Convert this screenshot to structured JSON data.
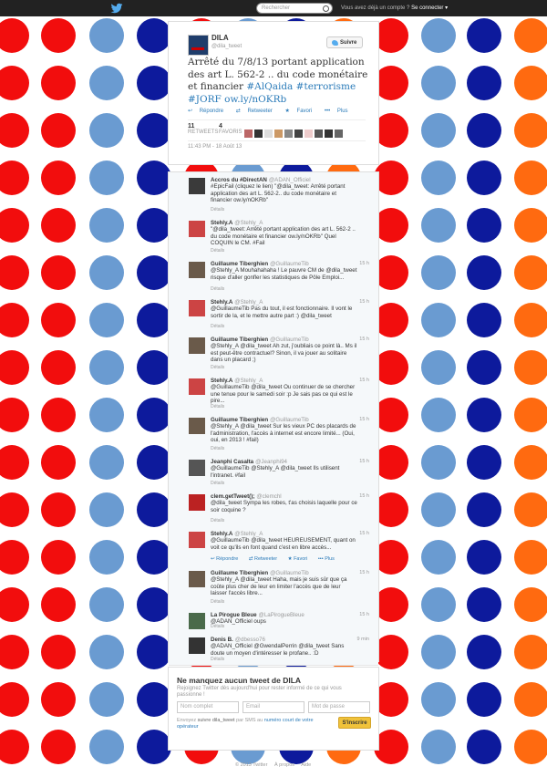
{
  "colors": {
    "red": "#f20d0d",
    "lightblue": "#6a9bd1",
    "navy": "#0d1a9c",
    "orange": "#ff6a10",
    "link": "#2b7bb9",
    "topbar": "#222222"
  },
  "topbar": {
    "search_placeholder": "Rechercher",
    "account_text": "Vous avez déjà un compte ?",
    "login_label": "Se connecter"
  },
  "tweet": {
    "name": "DILA",
    "handle": "@dila_tweet",
    "follow_label": "Suivre",
    "text_plain": "Arrêté du 7/8/13 portant application des art L. 562-2 .. du code monétaire et financier ",
    "hashtag1": "#AlQaida",
    "hashtag2": "#terrorisme",
    "hashtag3": "#JORF",
    "link": "ow.ly/nOKRb",
    "actions": {
      "reply": "Répondre",
      "retweet": "Retweeter",
      "fav": "Favori",
      "more": "Plus"
    },
    "retweets_count": "11",
    "retweets_label": "RETWEETS",
    "favs_count": "4",
    "favs_label": "FAVORIS",
    "timestamp": "11:43 PM - 18 Août 13"
  },
  "replies": [
    {
      "name": "Accros du #DirectAN",
      "handle": "@ADAN_Officiel",
      "time": "",
      "text": "#EpicFail (cliquez le lien) \"@dila_tweet: Arrêté portant application des art L. 562-2.. du code monétaire et financier ow.ly/nOKRb\"",
      "details": "Détails"
    },
    {
      "name": "Stehly.A",
      "handle": "@Stehly_A",
      "time": "",
      "text": "\"@dila_tweet: Arrêté portant application des art L. 562-2 .. du code monétaire et financier ow.ly/nOKRb\" Quel COQUIN le CM. #Fail",
      "details": "Détails"
    },
    {
      "name": "Guillaume Tiberghien",
      "handle": "@GuillaumeTib",
      "time": "15 h",
      "text": "@Stehly_A Mouhahahaha ! Le pauvre CM de @dila_tweet risque d'aller gonfler les statistiques de Pôle Emploi...",
      "details": "Détails"
    },
    {
      "name": "Stehly.A",
      "handle": "@Stehly_A",
      "time": "15 h",
      "text": "@GuillaumeTib Pas du tout, il est fonctionnaire. Il vont le sortir de la, et le mettre autre part :) @dila_tweet",
      "details": "Détails"
    },
    {
      "name": "Guillaume Tiberghien",
      "handle": "@GuillaumeTib",
      "time": "15 h",
      "text": "@Stehly_A @dila_tweet Ah zut, j'oubliais ce point là.. Ms il est peut-être contractuel? Sinon, il va jouer au solitaire dans un placard ;)",
      "details": "Détails"
    },
    {
      "name": "Stehly.A",
      "handle": "@Stehly_A",
      "time": "15 h",
      "text": "@GuillaumeTib @dila_tweet Ou continuer de se chercher une tenue pour le samedi soir :p Je sais pas ce qui est le pire...",
      "details": "Détails"
    },
    {
      "name": "Guillaume Tiberghien",
      "handle": "@GuillaumeTib",
      "time": "15 h",
      "text": "@Stehly_A @dila_tweet Sur les vieux PC des placards de l'administration, l'accès à internet est encore limité... (Oui, oui, en 2013 ! #fail)",
      "details": "Détails"
    },
    {
      "name": "Jeanphi Casalta",
      "handle": "@Jeanphi94",
      "time": "15 h",
      "text": "@GuillaumeTib @Stehly_A @dila_tweet Ils utilisent l'intranet. #fail",
      "details": "Détails"
    },
    {
      "name": "clem.getTweet();",
      "handle": "@clemchl",
      "time": "15 h",
      "text": "@dila_tweet Sympa les robes, t'as choisis laquelle pour ce soir coquine ?",
      "details": "Détails"
    },
    {
      "name": "Stehly.A",
      "handle": "@Stehly_A",
      "time": "15 h",
      "text": "@GuillaumeTib @dila_tweet HEUREUSEMENT, quant on voit ce qu'ils en font quand c'est en libre accès...",
      "details": ""
    },
    {
      "name": "Guillaume Tiberghien",
      "handle": "@GuillaumeTib",
      "time": "15 h",
      "text": "@Stehly_A @dila_tweet Haha, mais je suis sûr que ça coûte plus cher de leur en limiter l'accès que de leur laisser l'accès libre...",
      "details": "Détails"
    },
    {
      "name": "La Pirogue Bleue",
      "handle": "@LaPirogueBleue",
      "time": "15 h",
      "text": "@ADAN_Officiel oups",
      "details": "Détails"
    },
    {
      "name": "Denis B.",
      "handle": "@dbesso76",
      "time": "9 min",
      "text": "@ADAN_Officiel @GwendalPerrin @dila_tweet Sans doute un moyen d'intéresser le profane.. :D",
      "details": "Détails"
    }
  ],
  "reply_actions": {
    "reply": "Répondre",
    "retweet": "Retweeter",
    "fav": "Favori",
    "more": "Plus"
  },
  "signup": {
    "title": "Ne manquez aucun tweet de DILA",
    "subtitle": "Rejoignez Twitter dès aujourd'hui pour rester informé de ce qui vous passionne !",
    "name_placeholder": "Nom complet",
    "email_placeholder": "Email",
    "password_placeholder": "Mot de passe",
    "note_prefix": "Envoyez ",
    "note_code": "suivre dila_tweet",
    "note_mid": " par SMS au ",
    "note_link": "numéro court de votre opérateur",
    "button": "S'inscrire"
  },
  "footer": {
    "copyright": "© 2013 Twitter",
    "about": "À propos",
    "help": "Aide"
  }
}
